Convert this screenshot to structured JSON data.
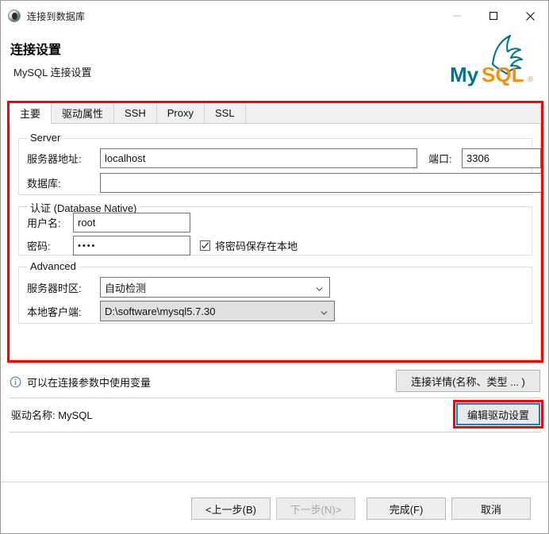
{
  "window": {
    "title": "连接到数据库",
    "app_icon": "dbeaver-icon",
    "controls": {
      "minimize": "minimize-icon",
      "maximize": "maximize-icon",
      "close": "close-icon"
    }
  },
  "header": {
    "title": "连接设置",
    "subtitle": "MySQL 连接设置",
    "logo_text_my": "My",
    "logo_text_sql": "SQL",
    "logo_mark": "®"
  },
  "tabs": [
    {
      "label": "主要",
      "active": true
    },
    {
      "label": "驱动属性",
      "active": false
    },
    {
      "label": "SSH",
      "active": false
    },
    {
      "label": "Proxy",
      "active": false
    },
    {
      "label": "SSL",
      "active": false
    }
  ],
  "server_group": {
    "title": "Server",
    "host_label": "服务器地址:",
    "host_value": "localhost",
    "host_placeholder": "",
    "port_label": "端口:",
    "port_value": "3306",
    "database_label": "数据库:",
    "database_value": "",
    "database_placeholder": ""
  },
  "auth_group": {
    "title": "认证 (Database Native)",
    "username_label": "用户名:",
    "username_value": "root",
    "password_label": "密码:",
    "password_value": "••••",
    "save_password_label": "将密码保存在本地",
    "save_password_checked": true,
    "check_glyph": "✓"
  },
  "advanced_group": {
    "title": "Advanced",
    "timezone_label": "服务器时区:",
    "timezone_value": "自动检测",
    "client_label": "本地客户端:",
    "client_value": "D:\\software\\mysql5.7.30"
  },
  "info": {
    "icon": "info-icon",
    "text": "可以在连接参数中使用变量",
    "details_button": "连接详情(名称、类型 ... )"
  },
  "driver": {
    "label": "驱动名称: MySQL",
    "edit_button": "编辑驱动设置"
  },
  "footer": {
    "back": "<上一步(B)",
    "next": "下一步(N)>",
    "finish": "完成(F)",
    "cancel": "取消"
  },
  "colors": {
    "annotation_red": "#ff0000",
    "focus_blue": "#1a7fd4",
    "mysql_teal": "#00758f",
    "mysql_orange": "#f29111"
  }
}
